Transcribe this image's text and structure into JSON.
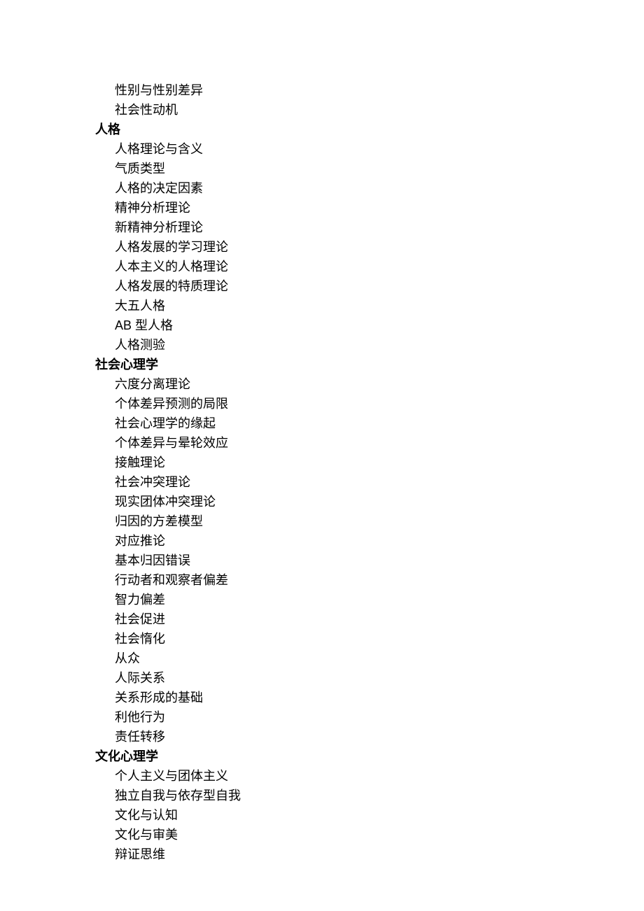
{
  "outline": [
    {
      "type": "sub",
      "text": "性别与性别差异"
    },
    {
      "type": "sub",
      "text": "社会性动机"
    },
    {
      "type": "heading",
      "text": "人格"
    },
    {
      "type": "sub",
      "text": "人格理论与含义"
    },
    {
      "type": "sub",
      "text": "气质类型"
    },
    {
      "type": "sub",
      "text": "人格的决定因素"
    },
    {
      "type": "sub",
      "text": "精神分析理论"
    },
    {
      "type": "sub",
      "text": "新精神分析理论"
    },
    {
      "type": "sub",
      "text": "人格发展的学习理论"
    },
    {
      "type": "sub",
      "text": "人本主义的人格理论"
    },
    {
      "type": "sub",
      "text": "人格发展的特质理论"
    },
    {
      "type": "sub",
      "text": "大五人格"
    },
    {
      "type": "sub",
      "text": "AB 型人格"
    },
    {
      "type": "sub",
      "text": "人格测验"
    },
    {
      "type": "heading",
      "text": "社会心理学"
    },
    {
      "type": "sub",
      "text": "六度分离理论"
    },
    {
      "type": "sub",
      "text": "个体差异预测的局限"
    },
    {
      "type": "sub",
      "text": "社会心理学的缘起"
    },
    {
      "type": "sub",
      "text": "个体差异与晕轮效应"
    },
    {
      "type": "sub",
      "text": "接触理论"
    },
    {
      "type": "sub",
      "text": "社会冲突理论"
    },
    {
      "type": "sub",
      "text": "现实团体冲突理论"
    },
    {
      "type": "sub",
      "text": "归因的方差模型"
    },
    {
      "type": "sub",
      "text": "对应推论"
    },
    {
      "type": "sub",
      "text": "基本归因错误"
    },
    {
      "type": "sub",
      "text": "行动者和观察者偏差"
    },
    {
      "type": "sub",
      "text": "智力偏差"
    },
    {
      "type": "sub",
      "text": "社会促进"
    },
    {
      "type": "sub",
      "text": "社会惰化"
    },
    {
      "type": "sub",
      "text": "从众"
    },
    {
      "type": "sub",
      "text": "人际关系"
    },
    {
      "type": "sub",
      "text": "关系形成的基础"
    },
    {
      "type": "sub",
      "text": "利他行为"
    },
    {
      "type": "sub",
      "text": "责任转移"
    },
    {
      "type": "heading",
      "text": "文化心理学"
    },
    {
      "type": "sub",
      "text": "个人主义与团体主义"
    },
    {
      "type": "sub",
      "text": "独立自我与依存型自我"
    },
    {
      "type": "sub",
      "text": "文化与认知"
    },
    {
      "type": "sub",
      "text": "文化与审美"
    },
    {
      "type": "sub",
      "text": "辩证思维"
    }
  ]
}
